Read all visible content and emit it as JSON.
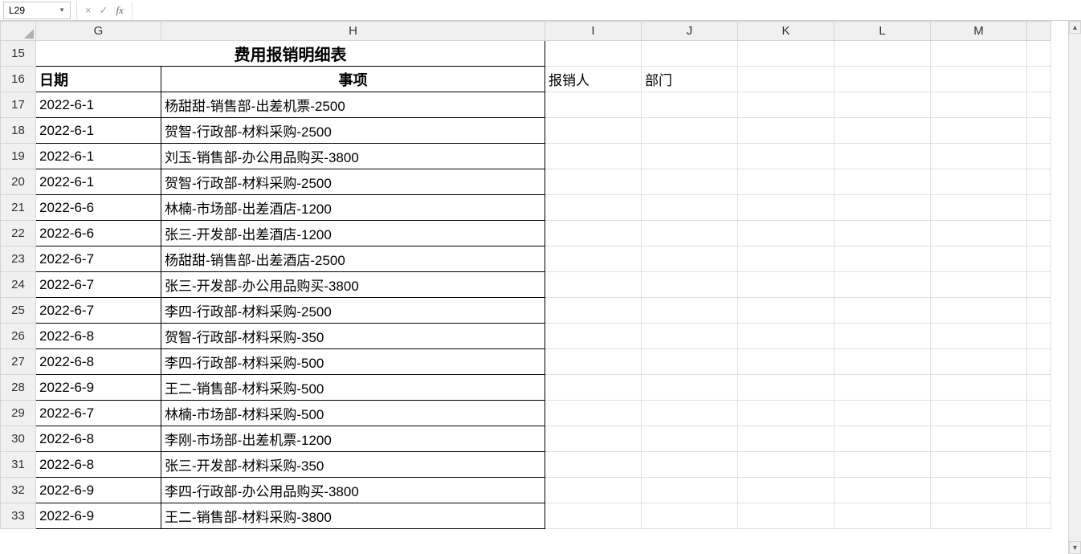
{
  "formula_bar": {
    "name_box": "L29",
    "cancel_icon": "×",
    "confirm_icon": "✓",
    "fx_label": "fx",
    "formula_value": ""
  },
  "columns": [
    "G",
    "H",
    "I",
    "J",
    "K",
    "L",
    "M"
  ],
  "row_numbers": [
    15,
    16,
    17,
    18,
    19,
    20,
    21,
    22,
    23,
    24,
    25,
    26,
    27,
    28,
    29,
    30,
    31,
    32,
    33
  ],
  "title": "费用报销明细表",
  "headers": {
    "date": "日期",
    "item": "事项",
    "reimburser": "报销人",
    "department": "部门"
  },
  "rows": [
    {
      "date": "2022-6-1",
      "item": "杨甜甜-销售部-出差机票-2500"
    },
    {
      "date": "2022-6-1",
      "item": "贺智-行政部-材料采购-2500"
    },
    {
      "date": "2022-6-1",
      "item": "刘玉-销售部-办公用品购买-3800"
    },
    {
      "date": "2022-6-1",
      "item": "贺智-行政部-材料采购-2500"
    },
    {
      "date": "2022-6-6",
      "item": "林楠-市场部-出差酒店-1200"
    },
    {
      "date": "2022-6-6",
      "item": "张三-开发部-出差酒店-1200"
    },
    {
      "date": "2022-6-7",
      "item": "杨甜甜-销售部-出差酒店-2500"
    },
    {
      "date": "2022-6-7",
      "item": "张三-开发部-办公用品购买-3800"
    },
    {
      "date": "2022-6-7",
      "item": "李四-行政部-材料采购-2500"
    },
    {
      "date": "2022-6-8",
      "item": "贺智-行政部-材料采购-350"
    },
    {
      "date": "2022-6-8",
      "item": "李四-行政部-材料采购-500"
    },
    {
      "date": "2022-6-9",
      "item": "王二-销售部-材料采购-500"
    },
    {
      "date": "2022-6-7",
      "item": "林楠-市场部-材料采购-500"
    },
    {
      "date": "2022-6-8",
      "item": "李刚-市场部-出差机票-1200"
    },
    {
      "date": "2022-6-8",
      "item": "张三-开发部-材料采购-350"
    },
    {
      "date": "2022-6-9",
      "item": "李四-行政部-办公用品购买-3800"
    },
    {
      "date": "2022-6-9",
      "item": "王二-销售部-材料采购-3800"
    }
  ]
}
